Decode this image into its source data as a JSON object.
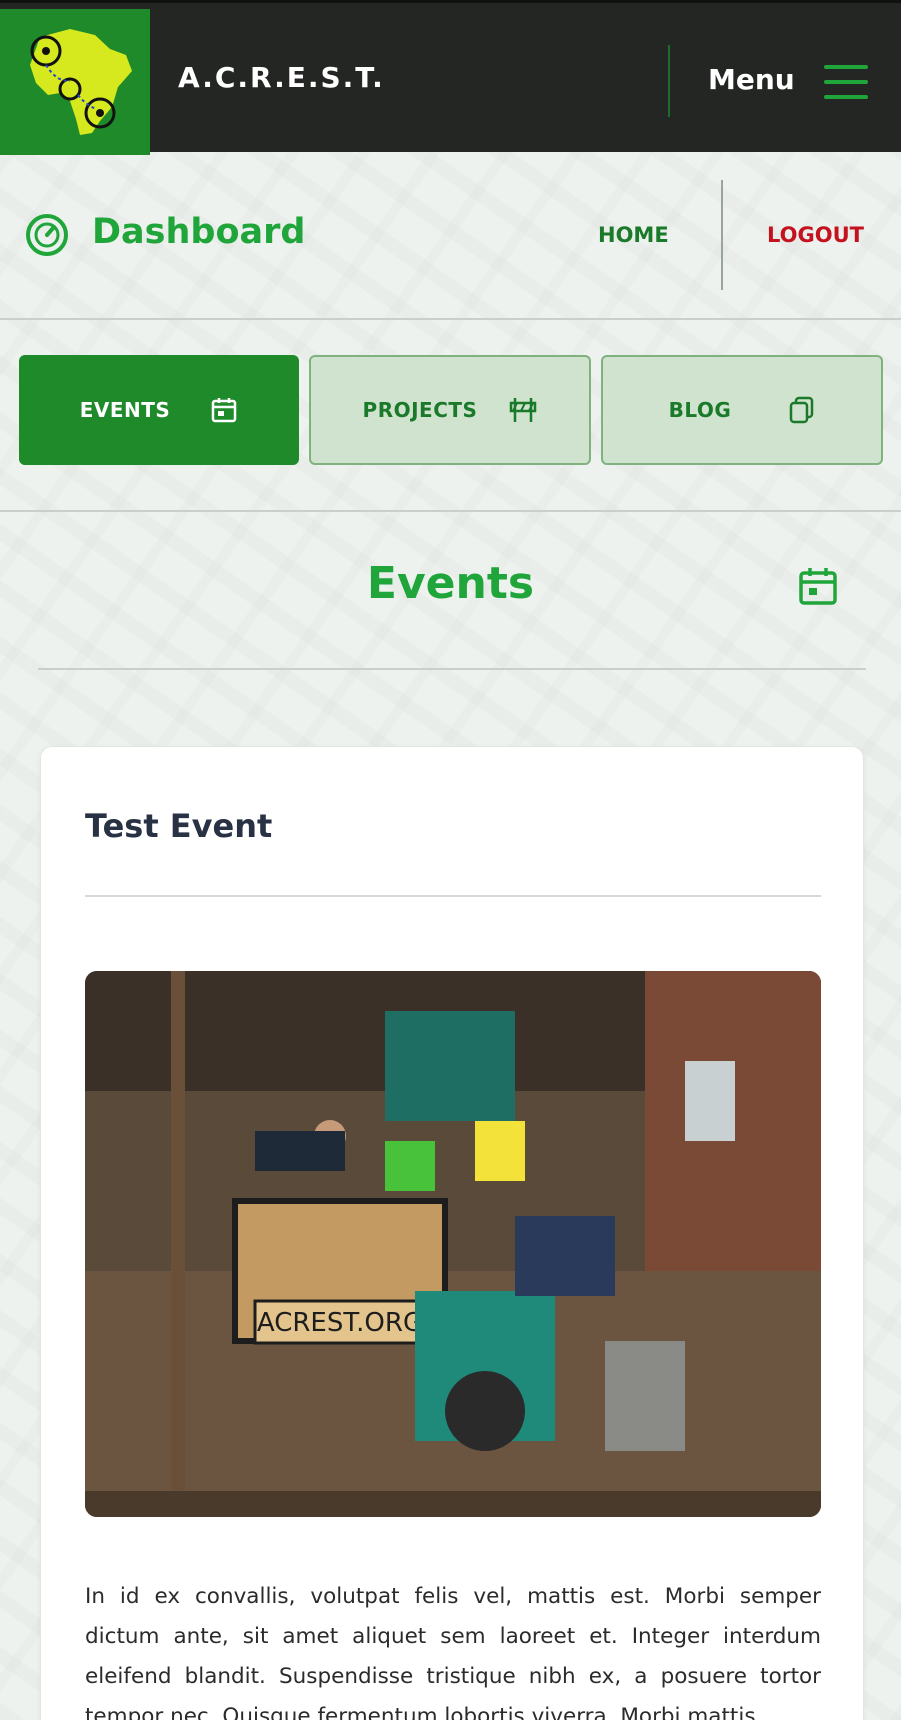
{
  "header": {
    "brand": "A.C.R.E.S.T.",
    "menu_label": "Menu"
  },
  "dashboard": {
    "title": "Dashboard",
    "home_label": "HOME",
    "logout_label": "LOGOUT"
  },
  "tabs": [
    {
      "label": "EVENTS",
      "icon": "calendar-icon",
      "active": true
    },
    {
      "label": "PROJECTS",
      "icon": "barrier-icon",
      "active": false
    },
    {
      "label": "BLOG",
      "icon": "pages-icon",
      "active": false
    }
  ],
  "section": {
    "title": "Events",
    "icon": "calendar-icon"
  },
  "event": {
    "title": "Test Event",
    "photo_caption": "ACREST.ORG",
    "description": "In id ex convallis, volutpat felis vel, mattis est. Morbi semper dictum ante, sit amet aliquet sem laoreet et. Integer interdum eleifend blandit. Suspendisse tristique nibh ex, a posuere tortor tempor nec. Quisque fermentum lobortis viverra. Morbi mattis"
  },
  "colors": {
    "brand_green": "#1fa53a",
    "dark_green": "#1f8a2a",
    "topbar": "#232623",
    "logout_red": "#c4121e"
  }
}
